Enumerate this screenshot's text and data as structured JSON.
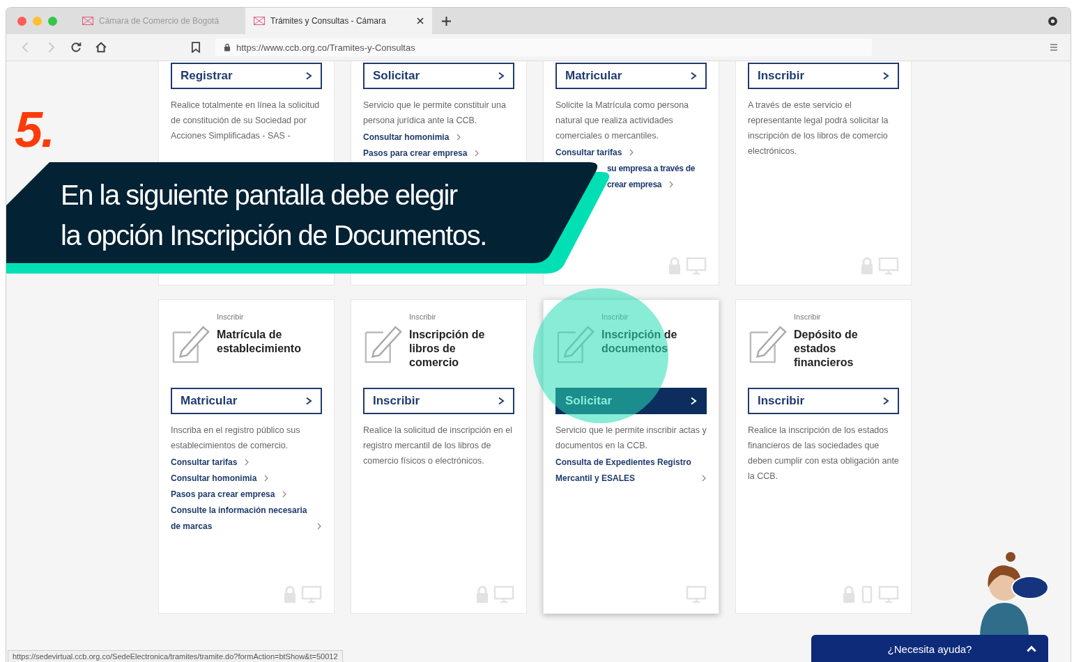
{
  "browser": {
    "tabs": [
      {
        "title": "Cámara de Comercio de Bogotá",
        "selected": false
      },
      {
        "title": "Trámites y Consultas - Cámara",
        "selected": true
      }
    ],
    "url": "https://www.ccb.org.co/Tramites-y-Consultas"
  },
  "top_cards": [
    {
      "button": "Registrar",
      "selected": false,
      "description": "Realice totalmente en línea la solicitud de constitución de su Sociedad por Acciones Simplificadas - SAS -"
    },
    {
      "button": "Solicitar",
      "selected": false,
      "description": "Servicio que le permite constituir una persona jurídica ante la CCB.",
      "links": [
        {
          "text": "Consultar homonimia",
          "partial": false,
          "arrow": true
        },
        {
          "text": "Pasos para crear empresa",
          "partial": false,
          "arrow": true
        }
      ]
    },
    {
      "button": "Matricular",
      "selected": false,
      "description": "Solicite la Matrícula como persona natural que realiza actividades comerciales o mercantiles.",
      "links": [
        {
          "text": "Consultar tarifas",
          "partial": false,
          "arrow": true
        },
        {
          "text": "su empresa a través de",
          "partial": true,
          "arrow": false
        },
        {
          "text": "crear empresa",
          "partial": true,
          "arrow": true
        }
      ],
      "icons": [
        {
          "kind": "lock"
        },
        {
          "kind": "monitor"
        }
      ]
    },
    {
      "button": "Inscribir",
      "selected": false,
      "description": "A través de este servicio el representante legal podrá solicitar la inscripción de los libros de comercio electrónicos.",
      "icons": [
        {
          "kind": "lock"
        },
        {
          "kind": "monitor"
        }
      ]
    }
  ],
  "bottom_cards": [
    {
      "category": "Inscribir",
      "title": "Matrícula de establecimiento",
      "button": "Matricular",
      "selected": false,
      "description": "Inscriba en el registro público sus establecimientos de comercio.",
      "links": [
        {
          "text": "Consultar tarifas",
          "arrow": true
        },
        {
          "text": "Consultar homonimia",
          "arrow": true
        },
        {
          "text": "Pasos para crear empresa",
          "arrow": true
        },
        {
          "text": "Consulte la información necesaria de marcas",
          "arrow": true
        }
      ],
      "icons": [
        {
          "kind": "lock"
        },
        {
          "kind": "monitor"
        }
      ]
    },
    {
      "category": "Inscribir",
      "title": "Inscripción de libros de comercio",
      "button": "Inscribir",
      "selected": false,
      "description": "Realice la solicitud de inscripción en el registro mercantil de los libros de comercio físicos o electrónicos.",
      "icons": [
        {
          "kind": "lock"
        },
        {
          "kind": "monitor"
        }
      ]
    },
    {
      "category": "Inscribir",
      "title": "Inscripción de documentos",
      "button": "Solicitar",
      "selected": true,
      "description": "Servicio que le permite inscribir actas y documentos en la CCB.",
      "links": [
        {
          "text": "Consulta de Expedientes Registro Mercantil y ESALES",
          "arrow": true
        }
      ],
      "icons": [
        {
          "kind": "monitor"
        }
      ]
    },
    {
      "category": "Inscribir",
      "title": "Depósito de estados financieros",
      "button": "Inscribir",
      "selected": false,
      "description": "Realice la inscripción de los estados financieros de las sociedades que deben cumplir con esta obligación ante la CCB.",
      "icons": [
        {
          "kind": "lock"
        },
        {
          "kind": "phone"
        },
        {
          "kind": "monitor"
        }
      ]
    }
  ],
  "status_url": "https://sedevirtual.ccb.org.co/SedeElectronica/tramites/tramite.do?formAction=btShow&t=50012",
  "help_button": "¿Necesita ayuda?",
  "step": {
    "number": "5.",
    "lines": [
      "En la siguiente pantalla debe elegir",
      "la opción Inscripción de Documentos."
    ]
  }
}
